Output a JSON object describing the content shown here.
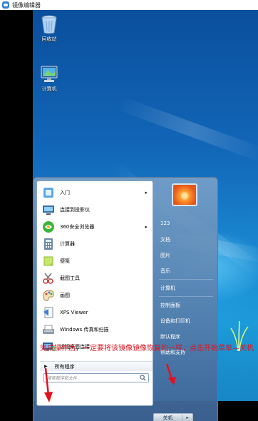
{
  "window": {
    "title": "镜像编辑器",
    "icon": "cloud-app-icon"
  },
  "desktop": {
    "icons": [
      {
        "label": "回收站",
        "icon": "recycle-bin-icon"
      },
      {
        "label": "计算机",
        "icon": "computer-icon"
      }
    ]
  },
  "start_menu": {
    "pinned": [
      {
        "label": "入门",
        "icon": "getting-started-icon",
        "submenu": "▸"
      },
      {
        "label": "连接到投影仪",
        "icon": "projector-icon",
        "submenu": ""
      },
      {
        "label": "360安全浏览器",
        "icon": "360-browser-icon",
        "submenu": "▸"
      },
      {
        "label": "计算器",
        "icon": "calculator-icon",
        "submenu": ""
      },
      {
        "label": "便笺",
        "icon": "sticky-notes-icon",
        "submenu": ""
      },
      {
        "label": "截图工具",
        "icon": "snipping-tool-icon",
        "submenu": ""
      },
      {
        "label": "画图",
        "icon": "paint-icon",
        "submenu": ""
      },
      {
        "label": "XPS Viewer",
        "icon": "xps-viewer-icon",
        "submenu": ""
      },
      {
        "label": "Windows 传真和扫描",
        "icon": "fax-scan-icon",
        "submenu": ""
      },
      {
        "label": "远程桌面连接",
        "icon": "remote-desktop-icon",
        "submenu": ""
      }
    ],
    "all_programs": "所有程序",
    "search_placeholder": "搜索程序和文件",
    "right_items": [
      "123",
      "文档",
      "图片",
      "音乐",
      "计算机",
      "控制面板",
      "设备和打印机",
      "默认程序",
      "帮助和支持"
    ],
    "shutdown_label": "关机",
    "shutdown_arrow": "▸"
  },
  "annotation": {
    "text": "完成操作后，一定要将该镜像镜像恢复的一样，点击开始菜单—关机",
    "color": "#e0121e"
  },
  "taskbar": {
    "items": [
      {
        "icon": "internet-explorer-icon"
      },
      {
        "icon": "windows-explorer-icon",
        "active": true
      },
      {
        "icon": "media-player-icon"
      }
    ]
  }
}
